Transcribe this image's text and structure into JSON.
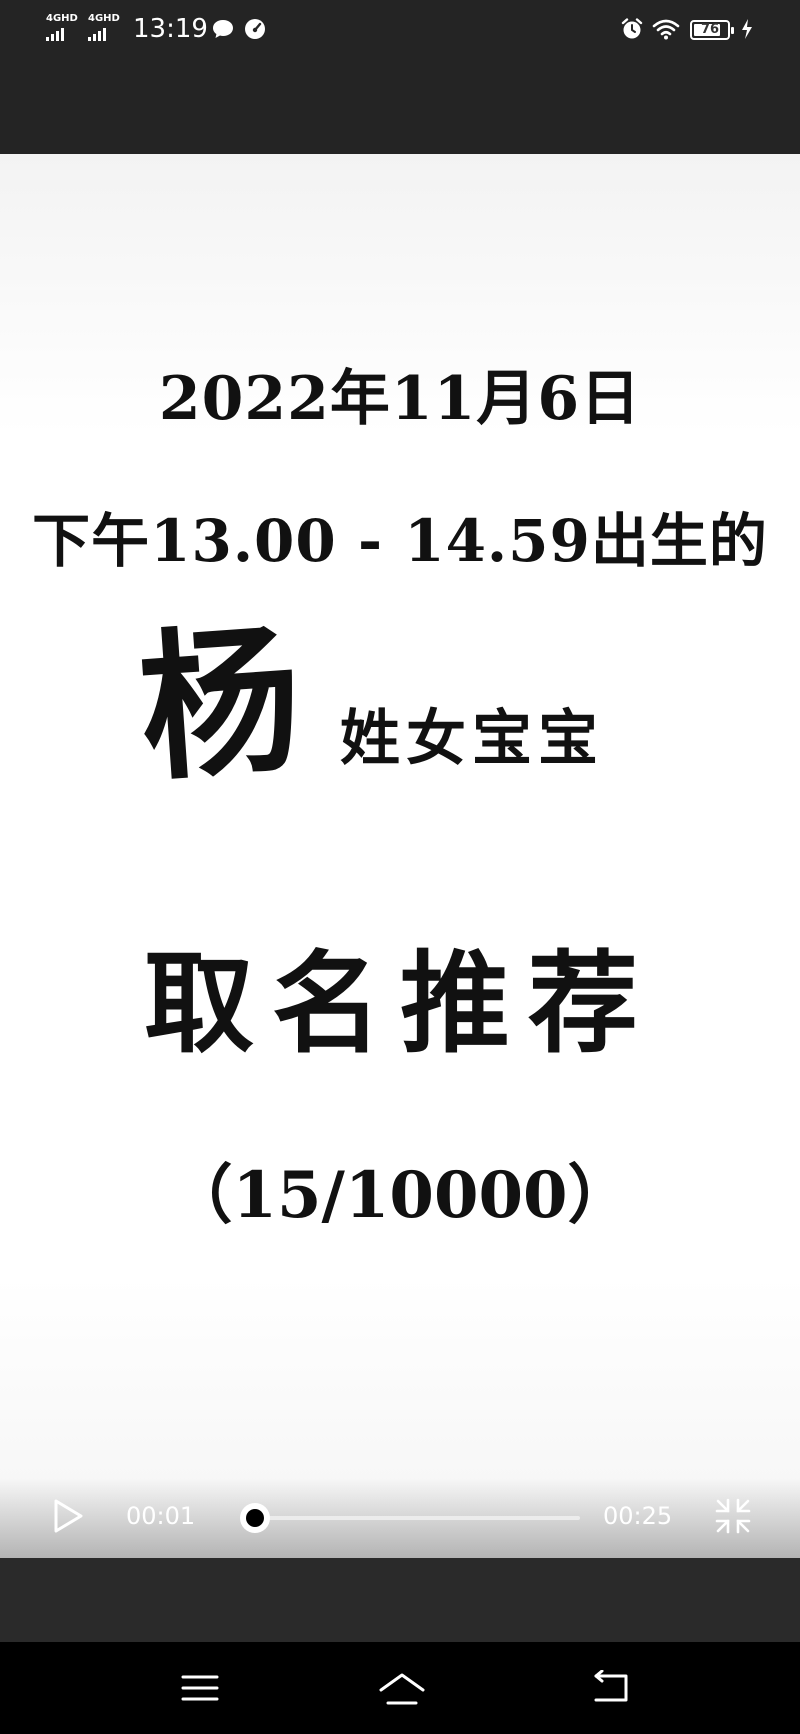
{
  "status_bar": {
    "network_1": "4GHD",
    "network_2": "4GHD",
    "time": "13:19",
    "battery": "76",
    "icons": [
      "chat-bubble-icon",
      "speedometer-icon",
      "alarm-icon",
      "wifi-icon",
      "charging-icon"
    ]
  },
  "video": {
    "line1": "2022年11月6日",
    "line2": "下午13.00 - 14.59出生的",
    "surname": "杨",
    "line3_rest": "姓女宝宝",
    "line4": "取名推荐",
    "line5": "（15/10000）"
  },
  "player": {
    "current_time": "00:01",
    "duration": "00:25",
    "progress_fraction": 0.04
  },
  "colors": {
    "status_bg": "#242424",
    "video_bg": "#ffffff",
    "text": "#111111",
    "nav_bg": "#000000"
  }
}
